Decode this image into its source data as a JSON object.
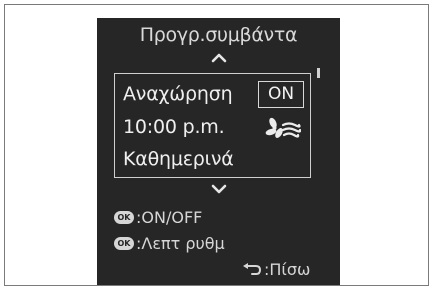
{
  "screen": {
    "title": "Προγρ.συμβάντα",
    "event": {
      "name": "Αναχώρηση",
      "status": "ON",
      "time": "10:00 p.m.",
      "repeat": "Καθημερινά",
      "mode_icon": "fan-airflow-icon"
    },
    "hints": {
      "ok_label": "OK",
      "toggle": ":ON/OFF",
      "details": ":Λεπτ ρυθμ",
      "back": ":Πίσω"
    }
  },
  "colors": {
    "screen_bg": "#262626",
    "text": "#efefef",
    "frame_border": "#7a7a7a"
  }
}
